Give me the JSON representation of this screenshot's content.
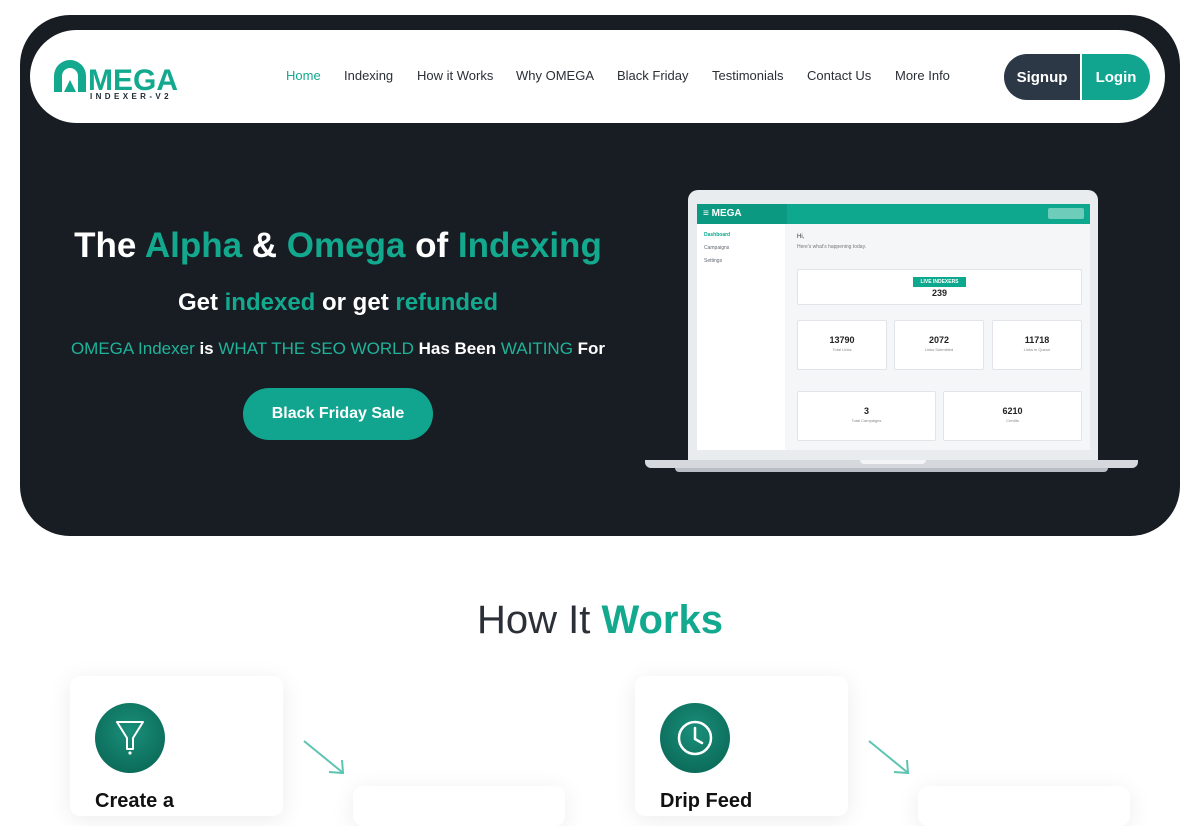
{
  "nav": {
    "logo_text": "MEGA",
    "logo_sub": "INDEXER-V2",
    "links": [
      "Home",
      "Indexing",
      "How it Works",
      "Why OMEGA",
      "Black Friday",
      "Testimonials",
      "Contact Us",
      "More Info"
    ],
    "signup": "Signup",
    "login": "Login"
  },
  "hero": {
    "h1_a": "The ",
    "h1_b": "Alpha",
    "h1_c": " & ",
    "h1_d": "Omega",
    "h1_e": " of ",
    "h1_f": "Indexing",
    "h2_a": "Get ",
    "h2_b": "indexed",
    "h2_c": " or get ",
    "h2_d": "refunded",
    "h3_a": "OMEGA Indexer",
    "h3_b": " is ",
    "h3_c": "WHAT THE SEO WORLD",
    "h3_d": " Has Been ",
    "h3_e": "WAITING",
    "h3_f": " For",
    "cta": "Black Friday Sale"
  },
  "dashboard": {
    "logo": "MEGA",
    "sidebar": [
      "Dashboard",
      "Campaigns",
      "Settings"
    ],
    "greeting": "Hi,",
    "greeting_sub": "Here's what's happening today.",
    "live_label": "LIVE INDEXERS",
    "live_value": "239",
    "stats": [
      {
        "value": "13790",
        "label": "Total Links"
      },
      {
        "value": "2072",
        "label": "Links Submitted"
      },
      {
        "value": "11718",
        "label": "Links in Queue"
      },
      {
        "value": "3",
        "label": "Total Campaigns"
      },
      {
        "value": "6210",
        "label": "Credits"
      }
    ]
  },
  "how": {
    "title_a": "How It ",
    "title_b": "Works",
    "steps": [
      "Create a",
      "Drip Feed"
    ]
  },
  "colors": {
    "accent": "#13a98f",
    "dark": "#181d23",
    "signup": "#2c3846"
  },
  "icons": [
    "funnel-icon",
    "clock-icon",
    "arrow-icon",
    "hamburger-icon"
  ]
}
